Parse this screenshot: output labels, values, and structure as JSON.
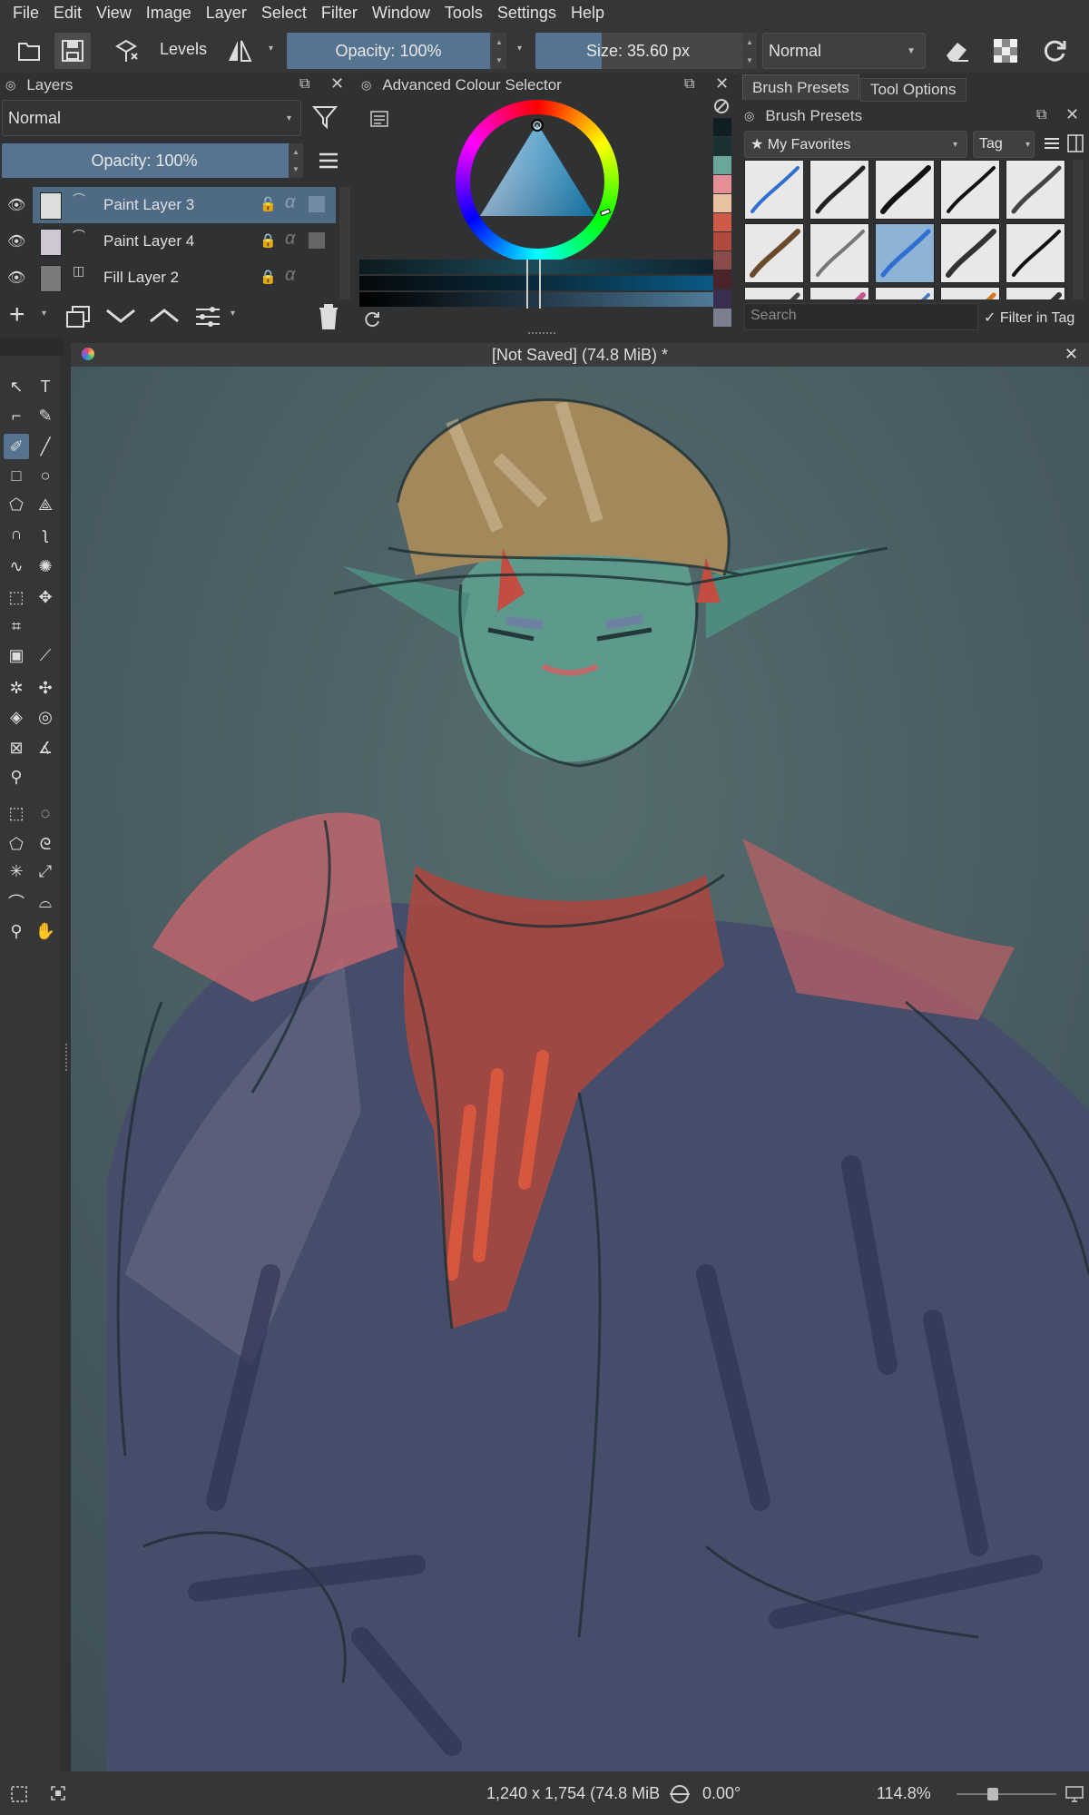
{
  "menu": [
    "File",
    "Edit",
    "View",
    "Image",
    "Layer",
    "Select",
    "Filter",
    "Window",
    "Tools",
    "Settings",
    "Help"
  ],
  "toolbar": {
    "filter_label": "Levels",
    "opacity": "Opacity: 100%",
    "opacity_fraction": 1.0,
    "size": "Size: 35.60 px",
    "size_fraction": 0.32,
    "blend_mode": "Normal"
  },
  "layers_panel": {
    "title": "Layers",
    "blend_mode": "Normal",
    "opacity": "Opacity:  100%",
    "layers": [
      {
        "name": "Paint Layer 3",
        "selected": true
      },
      {
        "name": "Paint Layer 4",
        "selected": false
      },
      {
        "name": "Fill Layer 2",
        "selected": false
      }
    ]
  },
  "colour_selector": {
    "title": "Advanced Colour Selector",
    "swatches": [
      "#0f1e22",
      "#1c2f33",
      "#6aa79a",
      "#e48f95",
      "#e8c2a0",
      "#d05a48",
      "#b04a3c",
      "#8a4b4b",
      "#4a2428",
      "#3b2f4f",
      "#7c7f90"
    ]
  },
  "brush_presets": {
    "tab_brush": "Brush Presets",
    "tab_tool": "Tool Options",
    "title": "Brush Presets",
    "tag_selected": "★ My Favorites",
    "tag_button": "Tag",
    "search_placeholder": "Search",
    "filter_in_tag": "✓ Filter in Tag"
  },
  "document": {
    "title": "[Not Saved]  (74.8 MiB)  *"
  },
  "status": {
    "dimensions": "1,240 x 1,754 (74.8 MiB",
    "rotation": "0.00°",
    "zoom": "114.8%"
  },
  "colors": {
    "accent": "#56748f",
    "panel_bg": "#303132",
    "chrome_bg": "#353637"
  }
}
